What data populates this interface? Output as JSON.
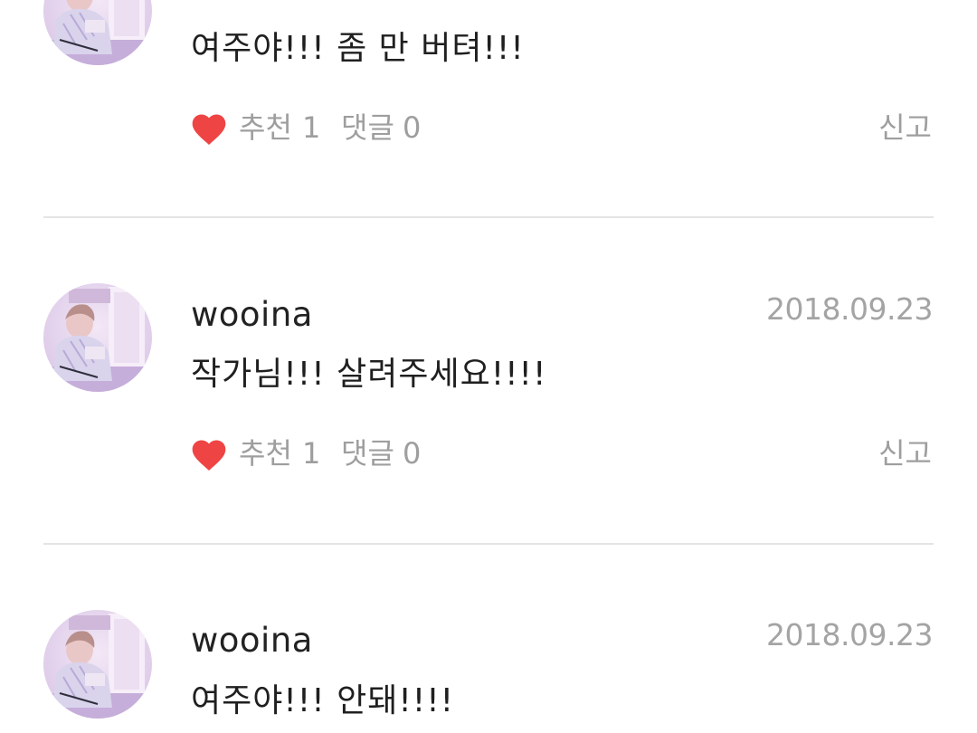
{
  "colors": {
    "heart": "#ef4444",
    "divider": "#e4e4e4",
    "username": "#222222",
    "meta": "#a4a4a4"
  },
  "icons": {
    "like": "heart-icon",
    "avatar": "user-avatar-image"
  },
  "comments": [
    {
      "username": "",
      "date": "",
      "text": "여주야!!! 좀 만 버텨!!!",
      "recommend_label": "추천",
      "recommend_count": "1",
      "reply_label": "댓글",
      "reply_count": "0",
      "report_label": "신고"
    },
    {
      "username": "wooina",
      "date": "2018.09.23",
      "text": "작가님!!! 살려주세요!!!!",
      "recommend_label": "추천",
      "recommend_count": "1",
      "reply_label": "댓글",
      "reply_count": "0",
      "report_label": "신고"
    },
    {
      "username": "wooina",
      "date": "2018.09.23",
      "text": "여주야!!! 안돼!!!!",
      "recommend_label": "",
      "recommend_count": "",
      "reply_label": "",
      "reply_count": "",
      "report_label": ""
    }
  ]
}
